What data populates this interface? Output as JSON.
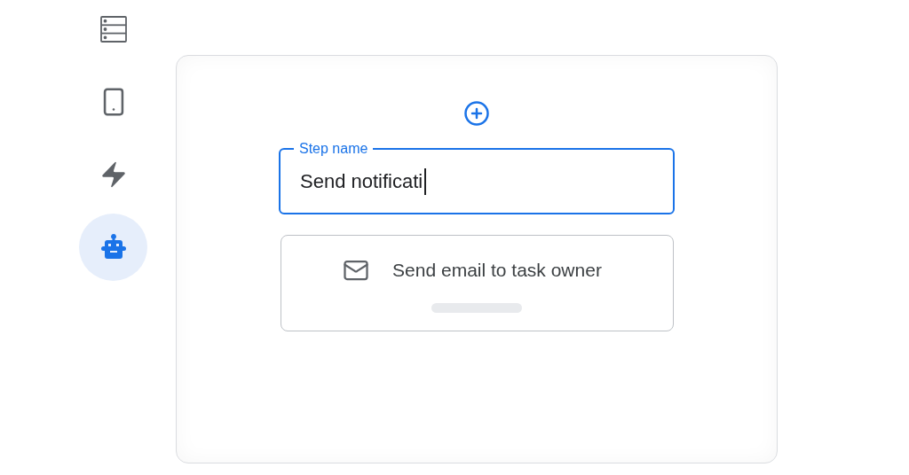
{
  "sidebar": {
    "items": [
      {
        "kind": "server",
        "selected": false
      },
      {
        "kind": "phone",
        "selected": false
      },
      {
        "kind": "bolt",
        "selected": false
      },
      {
        "kind": "robot",
        "selected": true
      }
    ]
  },
  "step_field": {
    "label": "Step name",
    "value": "Send notificati",
    "focused": true
  },
  "suggestion": {
    "text": "Send email to task owner"
  }
}
